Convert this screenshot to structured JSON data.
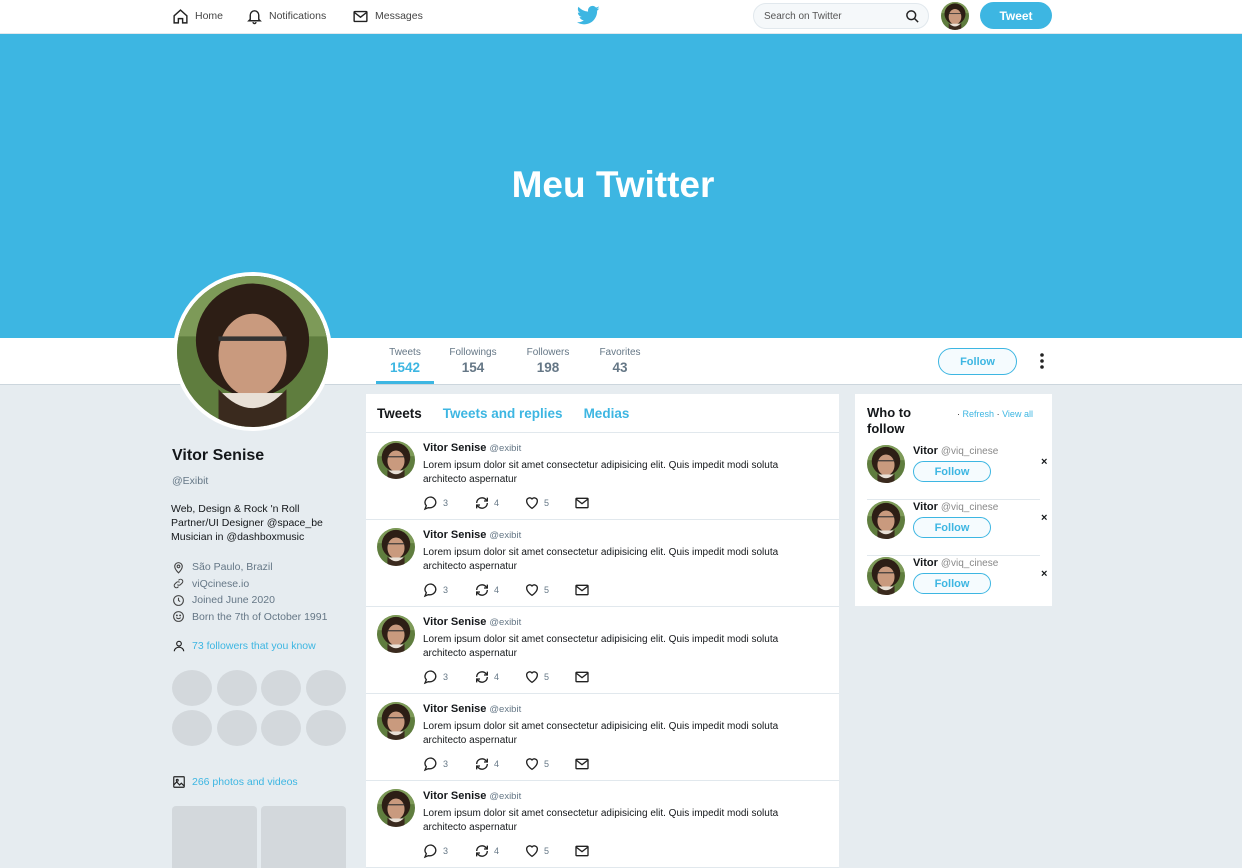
{
  "nav": {
    "home": "Home",
    "notifications": "Notifications",
    "messages": "Messages",
    "search_placeholder": "Search on Twitter",
    "tweet_button": "Tweet"
  },
  "banner": {
    "title": "Meu Twitter"
  },
  "stats": [
    {
      "label": "Tweets",
      "value": "1542"
    },
    {
      "label": "Followings",
      "value": "154"
    },
    {
      "label": "Followers",
      "value": "198"
    },
    {
      "label": "Favorites",
      "value": "43"
    }
  ],
  "profile": {
    "follow_label": "Follow",
    "name": "Vitor Senise",
    "handle": "@Exibit",
    "bio": [
      "Web, Design & Rock 'n Roll",
      "Partner/UI Designer @space_be",
      "Musician in @dashboxmusic"
    ],
    "location": "São Paulo, Brazil",
    "website": "viQcinese.io",
    "joined": "Joined June 2020",
    "born": "Born the 7th of October 1991",
    "followers_you_know": "73 followers that you know",
    "photos_videos": "266 photos and videos"
  },
  "timeline": {
    "tabs": [
      "Tweets",
      "Tweets and replies",
      "Medias"
    ],
    "tweets": [
      {
        "name": "Vitor Senise",
        "handle": "@exibit",
        "text": "Lorem ipsum dolor sit amet consectetur adipisicing elit. Quis impedit modi soluta architecto aspernatur",
        "replies": "3",
        "retweets": "4",
        "likes": "5"
      },
      {
        "name": "Vitor Senise",
        "handle": "@exibit",
        "text": "Lorem ipsum dolor sit amet consectetur adipisicing elit. Quis impedit modi soluta architecto aspernatur",
        "replies": "3",
        "retweets": "4",
        "likes": "5"
      },
      {
        "name": "Vitor Senise",
        "handle": "@exibit",
        "text": "Lorem ipsum dolor sit amet consectetur adipisicing elit. Quis impedit modi soluta architecto aspernatur",
        "replies": "3",
        "retweets": "4",
        "likes": "5"
      },
      {
        "name": "Vitor Senise",
        "handle": "@exibit",
        "text": "Lorem ipsum dolor sit amet consectetur adipisicing elit. Quis impedit modi soluta architecto aspernatur",
        "replies": "3",
        "retweets": "4",
        "likes": "5"
      },
      {
        "name": "Vitor Senise",
        "handle": "@exibit",
        "text": "Lorem ipsum dolor sit amet consectetur adipisicing elit. Quis impedit modi soluta architecto aspernatur",
        "replies": "3",
        "retweets": "4",
        "likes": "5"
      }
    ]
  },
  "who_to_follow": {
    "title": "Who to follow",
    "refresh": "Refresh",
    "view_all": "View all",
    "close": "×",
    "items": [
      {
        "name": "Vitor",
        "handle": "@viq_cinese",
        "button": "Follow"
      },
      {
        "name": "Vitor",
        "handle": "@viq_cinese",
        "button": "Follow"
      },
      {
        "name": "Vitor",
        "handle": "@viq_cinese",
        "button": "Follow"
      }
    ]
  },
  "colors": {
    "accent": "#3db6e2",
    "background": "#e6ecf0",
    "placeholder_gray": "#d3d8dc"
  },
  "icons": [
    "home-icon",
    "bell-icon",
    "mail-icon",
    "twitter-bird-icon",
    "search-icon",
    "more-vertical-icon",
    "location-pin-icon",
    "link-icon",
    "calendar-icon",
    "smiley-icon",
    "person-icon",
    "image-icon",
    "reply-icon",
    "retweet-icon",
    "heart-icon",
    "close-icon"
  ]
}
